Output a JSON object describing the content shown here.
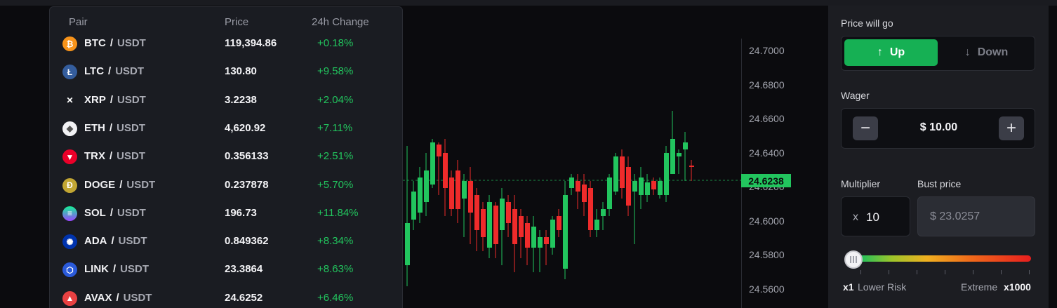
{
  "pairs": {
    "headers": {
      "pair": "Pair",
      "price": "Price",
      "change": "24h Change"
    },
    "separator": "/",
    "rows": [
      {
        "base": "BTC",
        "quote": "USDT",
        "price": "119,394.86",
        "change": "+0.18%",
        "icon": "btc-icon",
        "color": "#f7931a",
        "glyph": "₿"
      },
      {
        "base": "LTC",
        "quote": "USDT",
        "price": "130.80",
        "change": "+9.58%",
        "icon": "ltc-icon",
        "color": "#345d9d",
        "glyph": "Ł"
      },
      {
        "base": "XRP",
        "quote": "USDT",
        "price": "3.2238",
        "change": "+2.04%",
        "icon": "xrp-icon",
        "color": "#1a1c22",
        "glyph": "✕"
      },
      {
        "base": "ETH",
        "quote": "USDT",
        "price": "4,620.92",
        "change": "+7.11%",
        "icon": "eth-icon",
        "color": "#f2f2f5",
        "glyph": "◆"
      },
      {
        "base": "TRX",
        "quote": "USDT",
        "price": "0.356133",
        "change": "+2.51%",
        "icon": "trx-icon",
        "color": "#eb0029",
        "glyph": "▼"
      },
      {
        "base": "DOGE",
        "quote": "USDT",
        "price": "0.237878",
        "change": "+5.70%",
        "icon": "doge-icon",
        "color": "#c2a633",
        "glyph": "Ð"
      },
      {
        "base": "SOL",
        "quote": "USDT",
        "price": "196.73",
        "change": "+11.84%",
        "icon": "sol-icon",
        "color": "#14f195",
        "glyph": "≡"
      },
      {
        "base": "ADA",
        "quote": "USDT",
        "price": "0.849362",
        "change": "+8.34%",
        "icon": "ada-icon",
        "color": "#0033ad",
        "glyph": "✺"
      },
      {
        "base": "LINK",
        "quote": "USDT",
        "price": "23.3864",
        "change": "+8.63%",
        "icon": "link-icon",
        "color": "#2a5ada",
        "glyph": "⬡"
      },
      {
        "base": "AVAX",
        "quote": "USDT",
        "price": "24.6252",
        "change": "+6.46%",
        "icon": "avax-icon",
        "color": "#e84142",
        "glyph": "▲"
      }
    ]
  },
  "chart": {
    "y_ticks": [
      "24.7000",
      "24.6800",
      "24.6600",
      "24.6400",
      "24.6200",
      "24.6000",
      "24.5800",
      "24.5600"
    ],
    "current_price": "24.6238",
    "up_color": "#22c55e",
    "down_color": "#ef2b2b"
  },
  "panel": {
    "direction_label": "Price will go",
    "up_label": "Up",
    "down_label": "Down",
    "wager_label": "Wager",
    "wager_value": "$ 10.00",
    "minus": "−",
    "plus": "+",
    "multiplier_label": "Multiplier",
    "multiplier_prefix": "x",
    "multiplier_value": "10",
    "bust_label": "Bust price",
    "bust_value": "$ 23.0257",
    "risk_min_mult": "x1",
    "risk_min_label": "Lower Risk",
    "risk_max_label": "Extreme",
    "risk_max_mult": "x1000",
    "multiplier_level": 0.0
  }
}
